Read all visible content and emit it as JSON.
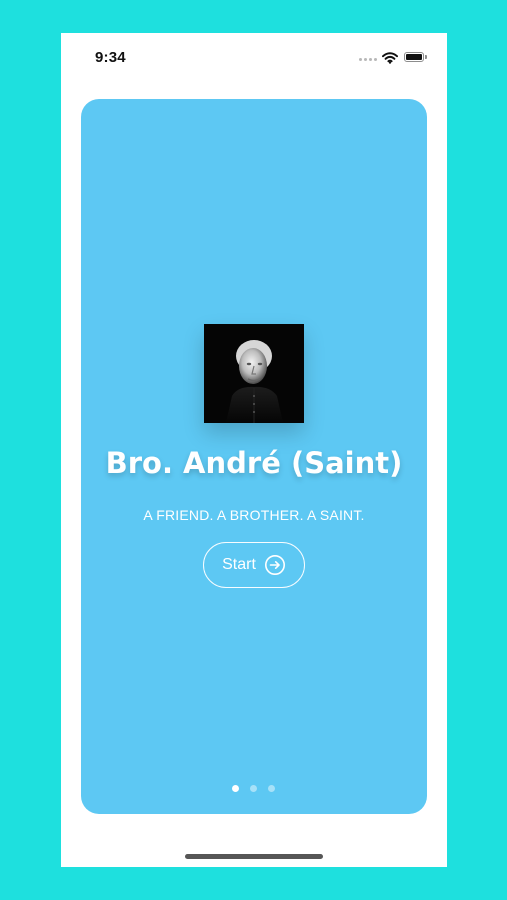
{
  "status_bar": {
    "time": "9:34",
    "icons": [
      "signal-dots-icon",
      "wifi-icon",
      "battery-icon"
    ]
  },
  "card": {
    "title": "Bro. André (Saint)",
    "subtitle": "A FRIEND. A BROTHER. A SAINT.",
    "start_label": "Start",
    "start_icon": "arrow-circle-right-icon",
    "portrait": "portrait-image",
    "page_count": 3,
    "active_page": 1
  },
  "colors": {
    "background": "#1ee0de",
    "card": "#5dc8f3",
    "text": "#ffffff",
    "phone": "#ffffff"
  }
}
